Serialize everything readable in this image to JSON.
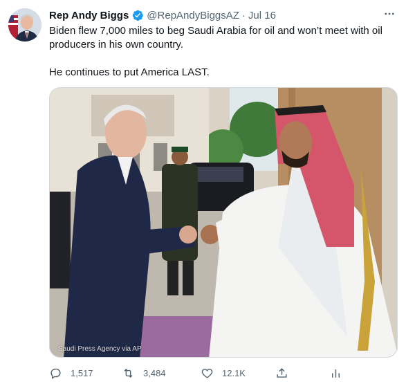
{
  "tweet": {
    "author_name": "Rep Andy Biggs",
    "handle": "@RepAndyBiggsAZ",
    "separator": "·",
    "date": "Jul 16",
    "text_1": "Biden flew 7,000 miles to beg Saudi Arabia for oil and won’t meet with oil producers in his own country.",
    "text_2": "He continues to put America LAST."
  },
  "media": {
    "credit": "Saudi Press Agency via AP"
  },
  "actions": {
    "replies": "1,517",
    "retweets": "3,484",
    "likes": "12.1K"
  },
  "icons": {
    "verified": "verified-badge-icon",
    "more": "more-options-icon",
    "reply": "reply-icon",
    "retweet": "retweet-icon",
    "like": "like-icon",
    "share": "share-icon",
    "analytics": "analytics-icon"
  },
  "colors": {
    "verified": "#1d9bf0",
    "text": "#0f1419",
    "secondary": "#536471"
  }
}
